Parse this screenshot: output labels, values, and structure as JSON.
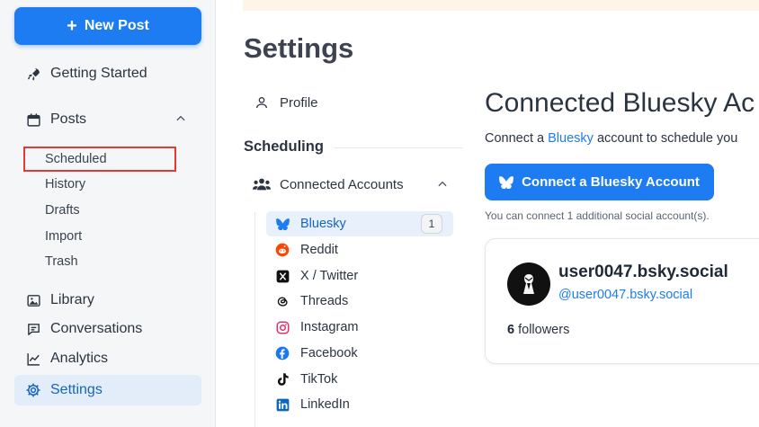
{
  "sidebar": {
    "new_post_label": "New Post",
    "nav": {
      "getting_started": "Getting Started",
      "posts": "Posts",
      "library": "Library",
      "conversations": "Conversations",
      "analytics": "Analytics",
      "settings": "Settings"
    },
    "posts_sub": {
      "scheduled": "Scheduled",
      "history": "History",
      "drafts": "Drafts",
      "import": "Import",
      "trash": "Trash"
    }
  },
  "settings": {
    "title": "Settings",
    "profile_label": "Profile",
    "scheduling_heading": "Scheduling",
    "connected_accounts_label": "Connected Accounts",
    "accounts": {
      "bluesky": "Bluesky",
      "bluesky_count": "1",
      "reddit": "Reddit",
      "x": "X / Twitter",
      "threads": "Threads",
      "instagram": "Instagram",
      "facebook": "Facebook",
      "tiktok": "TikTok",
      "linkedin": "LinkedIn"
    }
  },
  "main": {
    "heading": "Connected Bluesky Ac",
    "desc_before": "Connect a ",
    "desc_link": "Bluesky",
    "desc_after": " account to schedule you",
    "connect_button": "Connect a Bluesky Account",
    "hint": "You can connect 1 additional social account(s).",
    "account_card": {
      "display_name": "user0047.bsky.social",
      "handle": "@user0047.bsky.social",
      "followers_count": "6",
      "followers_label": " followers"
    }
  },
  "colors": {
    "accent": "#1d7cf2",
    "highlight_box": "#e53935",
    "active_bg": "#e3edf9"
  },
  "icons": {
    "new_post": "plus-icon",
    "getting_started": "rocket-icon",
    "posts": "calendar-icon",
    "library": "image-icon",
    "conversations": "chat-icon",
    "analytics": "chart-line-icon",
    "settings": "gear-icon"
  }
}
